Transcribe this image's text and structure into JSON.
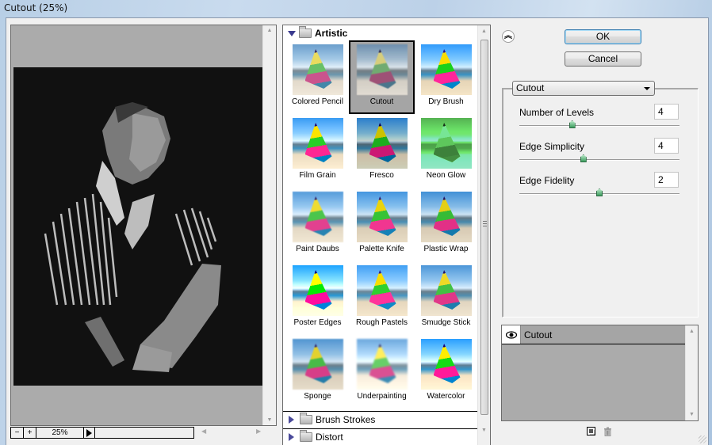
{
  "window": {
    "title": "Cutout (25%)"
  },
  "preview": {
    "zoom_out_label": "−",
    "zoom_in_label": "+",
    "zoom_value": "25%"
  },
  "gallery": {
    "open_category": "Artistic",
    "filters": [
      {
        "label": "Colored Pencil",
        "selected": false
      },
      {
        "label": "Cutout",
        "selected": true
      },
      {
        "label": "Dry Brush",
        "selected": false
      },
      {
        "label": "Film Grain",
        "selected": false
      },
      {
        "label": "Fresco",
        "selected": false
      },
      {
        "label": "Neon Glow",
        "selected": false
      },
      {
        "label": "Paint Daubs",
        "selected": false
      },
      {
        "label": "Palette Knife",
        "selected": false
      },
      {
        "label": "Plastic Wrap",
        "selected": false
      },
      {
        "label": "Poster Edges",
        "selected": false
      },
      {
        "label": "Rough Pastels",
        "selected": false
      },
      {
        "label": "Smudge Stick",
        "selected": false
      },
      {
        "label": "Sponge",
        "selected": false
      },
      {
        "label": "Underpainting",
        "selected": false
      },
      {
        "label": "Watercolor",
        "selected": false
      }
    ],
    "closed_categories": [
      "Brush Strokes",
      "Distort"
    ]
  },
  "buttons": {
    "ok": "OK",
    "cancel": "Cancel"
  },
  "settings": {
    "filter_select": "Cutout",
    "params": [
      {
        "label": "Number of Levels",
        "value": "4",
        "slider_fraction": 0.33
      },
      {
        "label": "Edge Simplicity",
        "value": "4",
        "slider_fraction": 0.4
      },
      {
        "label": "Edge Fidelity",
        "value": "2",
        "slider_fraction": 0.5
      }
    ]
  },
  "layers": {
    "items": [
      {
        "name": "Cutout",
        "visible": true
      }
    ]
  },
  "colors": {
    "ok_border": "#3c7fb1",
    "slider_thumb": "#3c9e5e",
    "panel_gray": "#ababab",
    "tri_blue": "#3b3b8f"
  }
}
